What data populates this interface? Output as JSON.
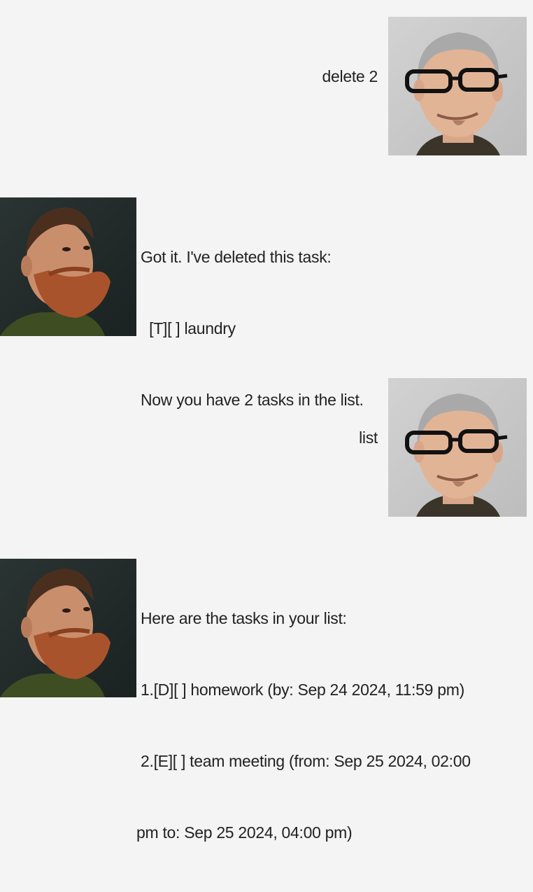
{
  "conversation": {
    "messages": [
      {
        "sender": "user",
        "avatar_icon": "user-avatar-glasses-icon",
        "lines": [
          "delete 2"
        ]
      },
      {
        "sender": "bot",
        "avatar_icon": "bot-avatar-bearded-icon",
        "lines": [
          "Got it. I've deleted this task:",
          "  [T][ ] laundry",
          "Now you have 2 tasks in the list."
        ]
      },
      {
        "sender": "user",
        "avatar_icon": "user-avatar-glasses-icon",
        "lines": [
          "list"
        ]
      },
      {
        "sender": "bot",
        "avatar_icon": "bot-avatar-bearded-icon",
        "lines": [
          "Here are the tasks in your list:",
          "1.[D][ ] homework (by: Sep 24 2024, 11:59 pm)",
          "2.[E][ ] team meeting (from: Sep 25 2024, 02:00",
          "pm to: Sep 25 2024, 04:00 pm)"
        ]
      }
    ]
  },
  "colors": {
    "background": "#f4f4f4",
    "text": "#222222"
  }
}
